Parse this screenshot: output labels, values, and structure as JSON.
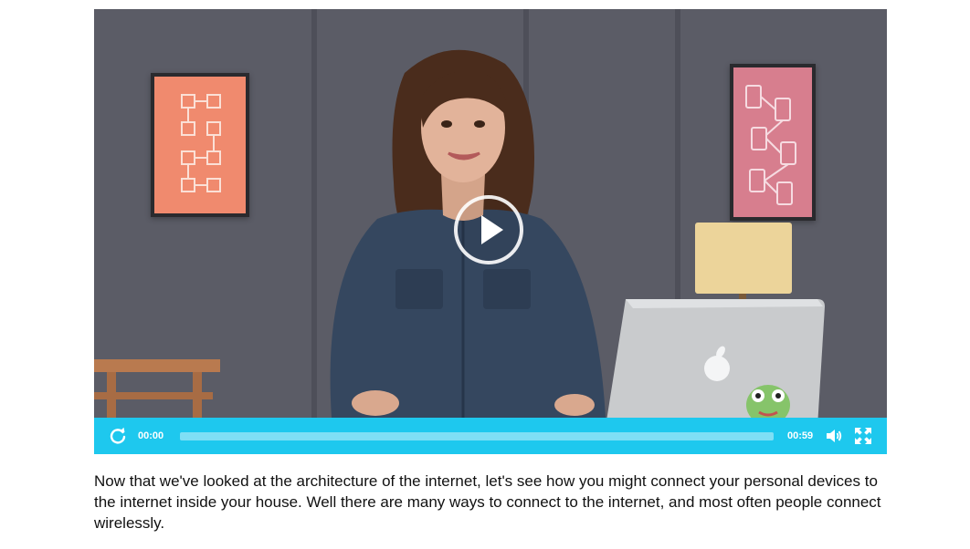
{
  "video": {
    "state": "paused",
    "play_icon": "play-icon",
    "progress_fraction": 0.0
  },
  "controls": {
    "current_time": "00:00",
    "total_time": "00:59",
    "icons": [
      "replay-icon",
      "volume-icon",
      "fullscreen-icon"
    ],
    "bar_color": "#1ec8ee"
  },
  "transcript": {
    "text": "Now that we've looked at the architecture of the internet, let's see how you might connect your personal devices to the internet inside your house. Well there are many ways to connect to the internet, and most often people connect wirelessly."
  }
}
